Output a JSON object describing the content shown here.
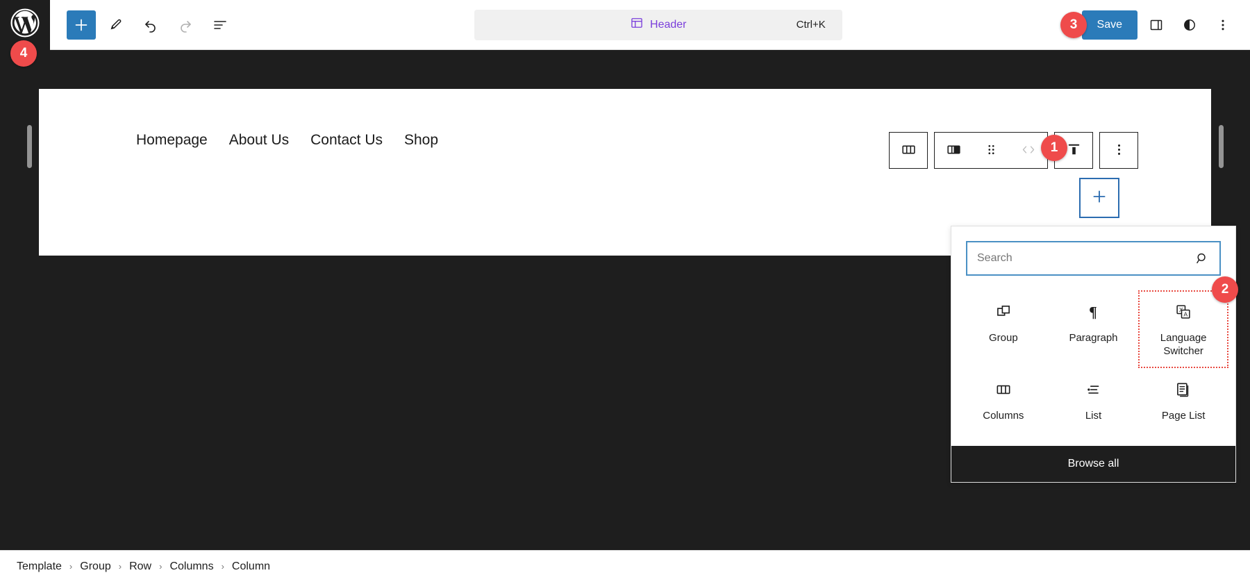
{
  "topbar": {
    "logo_icon": "wordpress-logo-icon",
    "tools": [
      {
        "name": "add-block-button",
        "icon": "plus-icon",
        "label": "Add block",
        "primary": true
      },
      {
        "name": "edit-tool-button",
        "icon": "pencil-icon",
        "label": "Edit"
      },
      {
        "name": "undo-button",
        "icon": "undo-arrow-icon",
        "label": "Undo"
      },
      {
        "name": "redo-button",
        "icon": "redo-arrow-icon",
        "label": "Redo",
        "disabled": true
      },
      {
        "name": "list-view-button",
        "icon": "list-view-icon",
        "label": "Document Overview"
      }
    ],
    "document": {
      "icon": "template-part-icon",
      "title": "Header",
      "shortcut": "Ctrl+K",
      "title_color": "#7a3edb"
    },
    "save_label": "Save",
    "save_color": "#2b7bb9",
    "right_tools": [
      {
        "name": "settings-sidebar-button",
        "icon": "sidebar-panel-icon",
        "label": "Settings"
      },
      {
        "name": "styles-button",
        "icon": "half-circle-contrast-icon",
        "label": "Styles"
      },
      {
        "name": "options-menu-button",
        "icon": "three-dots-vertical-icon",
        "label": "Options"
      }
    ]
  },
  "canvas": {
    "nav_items": [
      {
        "label": "Homepage"
      },
      {
        "label": "About Us"
      },
      {
        "label": "Contact Us"
      },
      {
        "label": "Shop"
      }
    ],
    "resize_handles": [
      "left-resize-handle",
      "right-resize-handle"
    ]
  },
  "block_toolbar": {
    "groups": [
      {
        "name": "parent-block-group",
        "buttons": [
          {
            "name": "select-parent-columns-button",
            "icon": "columns-icon"
          }
        ]
      },
      {
        "name": "block-controls-group",
        "buttons": [
          {
            "name": "change-block-type-button",
            "icon": "column-block-icon"
          },
          {
            "name": "drag-handle-button",
            "icon": "drag-dots-icon"
          },
          {
            "name": "move-arrows-button",
            "icon": "chevron-left-right-icon",
            "disabled": true
          }
        ]
      },
      {
        "name": "alignment-group",
        "buttons": [
          {
            "name": "vertical-align-top-button",
            "icon": "align-top-icon"
          }
        ]
      },
      {
        "name": "more-options-group",
        "buttons": [
          {
            "name": "block-options-button",
            "icon": "three-dots-vertical-icon"
          }
        ]
      }
    ]
  },
  "inline_inserter": {
    "name": "inline-add-block-button",
    "icon": "plus-icon",
    "border_color": "#2b6cb0"
  },
  "inserter_popover": {
    "search": {
      "placeholder": "Search",
      "value": "",
      "icon": "search-magnifier-icon",
      "border_color": "#4a90c4"
    },
    "blocks": [
      {
        "name": "block-group",
        "label": "Group",
        "icon": "group-blocks-icon",
        "highlighted": false
      },
      {
        "name": "block-paragraph",
        "label": "Paragraph",
        "icon": "pilcrow-paragraph-icon",
        "highlighted": false
      },
      {
        "name": "block-language-switcher",
        "label": "Language Switcher",
        "icon": "translate-icon",
        "highlighted": true
      },
      {
        "name": "block-columns",
        "label": "Columns",
        "icon": "columns-icon",
        "highlighted": false
      },
      {
        "name": "block-list",
        "label": "List",
        "icon": "bulleted-list-icon",
        "highlighted": false
      },
      {
        "name": "block-page-list",
        "label": "Page List",
        "icon": "page-list-icon",
        "highlighted": false
      }
    ],
    "highlight_color": "#e8483f",
    "browse_all_label": "Browse all"
  },
  "breadcrumb": {
    "separator": "›",
    "items": [
      {
        "label": "Template"
      },
      {
        "label": "Group"
      },
      {
        "label": "Row"
      },
      {
        "label": "Columns"
      },
      {
        "label": "Column"
      }
    ]
  },
  "step_badges": [
    {
      "name": "step-badge-1",
      "label": "1"
    },
    {
      "name": "step-badge-2",
      "label": "2"
    },
    {
      "name": "step-badge-3",
      "label": "3"
    },
    {
      "name": "step-badge-4",
      "label": "4"
    }
  ]
}
